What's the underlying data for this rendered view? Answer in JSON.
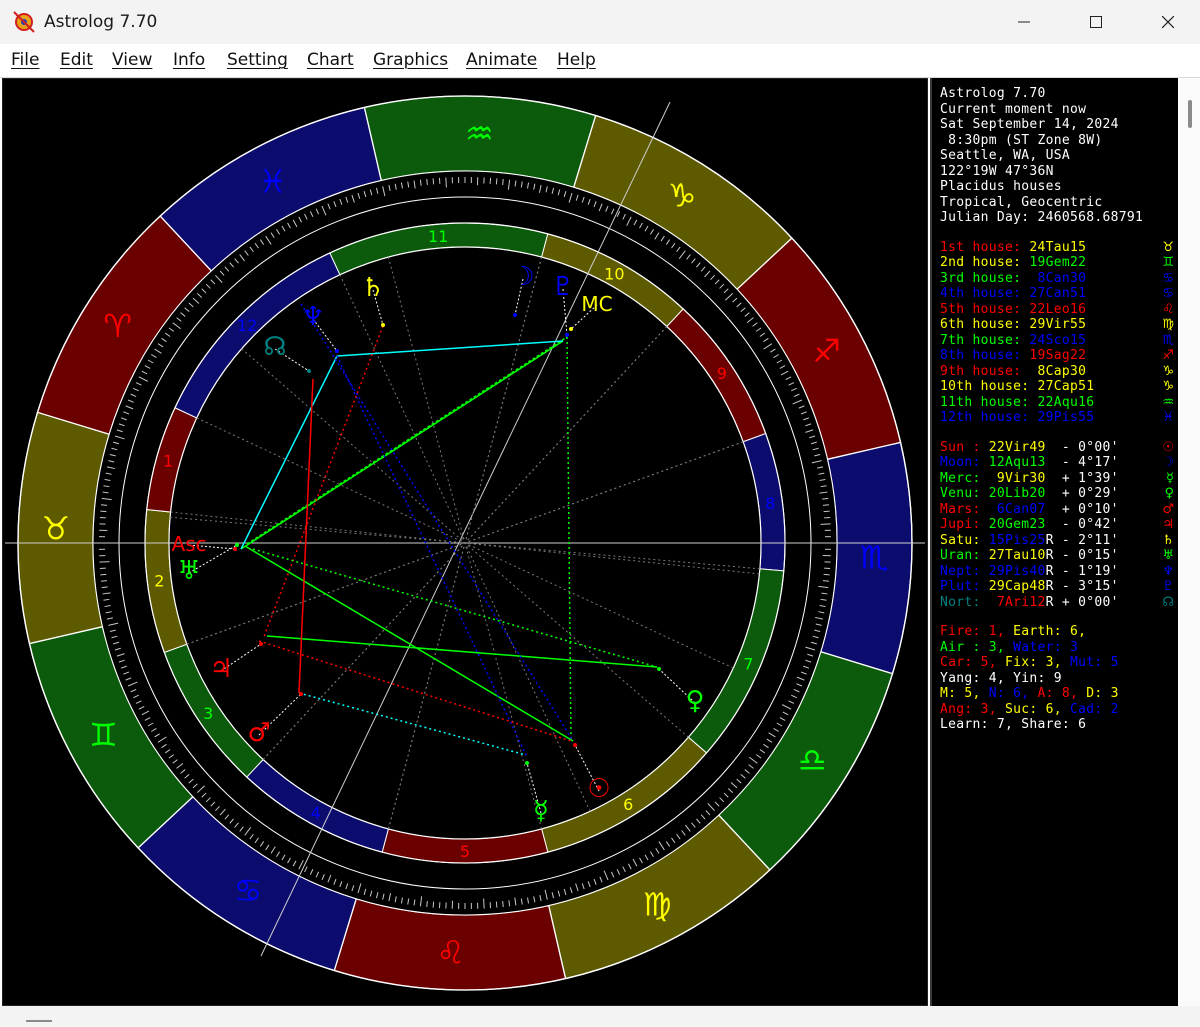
{
  "window": {
    "title": "Astrolog 7.70"
  },
  "menu": [
    {
      "label": "File"
    },
    {
      "label": "Edit"
    },
    {
      "label": "View"
    },
    {
      "label": "Info"
    },
    {
      "label": "Setting"
    },
    {
      "label": "Chart"
    },
    {
      "label": "Graphics"
    },
    {
      "label": "Animate"
    },
    {
      "label": "Help"
    }
  ],
  "chart": {
    "signs": [
      {
        "symbol": "♓",
        "color": "#0000ff"
      },
      {
        "symbol": "♒",
        "color": "#00ff00"
      },
      {
        "symbol": "♑",
        "color": "#ffff00"
      },
      {
        "symbol": "♐",
        "color": "#ff0000"
      },
      {
        "symbol": "♏",
        "color": "#0000ff"
      },
      {
        "symbol": "♎",
        "color": "#00ff00"
      },
      {
        "symbol": "♍",
        "color": "#ffff00"
      },
      {
        "symbol": "♌",
        "color": "#ff0000"
      },
      {
        "symbol": "♋",
        "color": "#0000ff"
      },
      {
        "symbol": "♊",
        "color": "#00ff00"
      },
      {
        "symbol": "♉",
        "color": "#ffff00"
      },
      {
        "symbol": "♈",
        "color": "#ff0000"
      }
    ],
    "houses": [
      {
        "num": "11",
        "color": "#00ff00"
      },
      {
        "num": "10",
        "color": "#ffff00"
      },
      {
        "num": "9",
        "color": "#ff0000"
      },
      {
        "num": "8",
        "color": "#0000ff"
      },
      {
        "num": "7",
        "color": "#00ff00"
      },
      {
        "num": "6",
        "color": "#ffff00"
      },
      {
        "num": "5",
        "color": "#ff0000"
      },
      {
        "num": "4",
        "color": "#0000ff"
      },
      {
        "num": "3",
        "color": "#00ff00"
      },
      {
        "num": "2",
        "color": "#ffff00"
      },
      {
        "num": "1",
        "color": "#ff0000"
      },
      {
        "num": "12",
        "color": "#0000ff"
      }
    ],
    "points": [
      {
        "name": "Saturn",
        "glyph": "♄",
        "color": "#ffff00"
      },
      {
        "name": "Neptune",
        "glyph": "♆",
        "color": "#0000ff"
      },
      {
        "name": "North Node",
        "glyph": "☊",
        "color": "#008080"
      },
      {
        "name": "Moon",
        "glyph": "☽",
        "color": "#0000ff"
      },
      {
        "name": "Pluto",
        "glyph": "♇",
        "color": "#0000ff"
      },
      {
        "name": "MC",
        "glyph": "MC",
        "color": "#ffff00"
      },
      {
        "name": "Asc",
        "glyph": "Asc",
        "color": "#ff0000"
      },
      {
        "name": "Uranus",
        "glyph": "♅",
        "color": "#00ff00"
      },
      {
        "name": "Jupiter",
        "glyph": "♃",
        "color": "#ff0000"
      },
      {
        "name": "Mars",
        "glyph": "♂",
        "color": "#ff0000"
      },
      {
        "name": "Venus",
        "glyph": "♀",
        "color": "#00ff00"
      },
      {
        "name": "Sun",
        "glyph": "☉",
        "color": "#ff0000"
      },
      {
        "name": "Mercury",
        "glyph": "☿",
        "color": "#00ff00"
      }
    ]
  },
  "info": {
    "header": [
      "Astrolog 7.70",
      "Current moment now",
      "Sat September 14, 2024",
      " 8:30pm (ST Zone 8W)",
      "Seattle, WA, USA",
      "122°19W 47°36N",
      "Placidus houses",
      "Tropical, Geocentric",
      "Julian Day: 2460568.68791"
    ],
    "houses": [
      {
        "label": "1st house:",
        "value": "24Tau15",
        "glyph": "♉",
        "color": "#ff0000",
        "vcolor": "#ffff00"
      },
      {
        "label": "2nd house:",
        "value": "19Gem22",
        "glyph": "♊",
        "color": "#ffff00",
        "vcolor": "#00ff00"
      },
      {
        "label": "3rd house:",
        "value": " 8Can30",
        "glyph": "♋",
        "color": "#00ff00",
        "vcolor": "#0000ff"
      },
      {
        "label": "4th house:",
        "value": "27Can51",
        "glyph": "♋",
        "color": "#0000ff",
        "vcolor": "#0000ff"
      },
      {
        "label": "5th house:",
        "value": "22Leo16",
        "glyph": "♌",
        "color": "#ff0000",
        "vcolor": "#ff0000"
      },
      {
        "label": "6th house:",
        "value": "29Vir55",
        "glyph": "♍",
        "color": "#ffff00",
        "vcolor": "#ffff00"
      },
      {
        "label": "7th house:",
        "value": "24Sco15",
        "glyph": "♏",
        "color": "#00ff00",
        "vcolor": "#0000ff"
      },
      {
        "label": "8th house:",
        "value": "19Sag22",
        "glyph": "♐",
        "color": "#0000ff",
        "vcolor": "#ff0000"
      },
      {
        "label": "9th house:",
        "value": " 8Cap30",
        "glyph": "♑",
        "color": "#ff0000",
        "vcolor": "#ffff00"
      },
      {
        "label": "10th house:",
        "value": "27Cap51",
        "glyph": "♑",
        "color": "#ffff00",
        "vcolor": "#ffff00"
      },
      {
        "label": "11th house:",
        "value": "22Aqu16",
        "glyph": "♒",
        "color": "#00ff00",
        "vcolor": "#00ff00"
      },
      {
        "label": "12th house:",
        "value": "29Pis55",
        "glyph": "♓",
        "color": "#0000ff",
        "vcolor": "#0000ff"
      }
    ],
    "planets": [
      {
        "label": "Sun :",
        "value": "22Vir49",
        "lat": "- 0°00'",
        "glyph": "☉",
        "color": "#ff0000",
        "vcolor": "#ffff00"
      },
      {
        "label": "Moon:",
        "value": "12Aqu13",
        "lat": "- 4°17'",
        "glyph": "☽",
        "color": "#0000ff",
        "vcolor": "#00ff00"
      },
      {
        "label": "Merc:",
        "value": " 9Vir30",
        "lat": "+ 1°39'",
        "glyph": "☿",
        "color": "#00ff00",
        "vcolor": "#ffff00"
      },
      {
        "label": "Venu:",
        "value": "20Lib20",
        "lat": "+ 0°29'",
        "glyph": "♀",
        "color": "#00ff00",
        "vcolor": "#00ff00"
      },
      {
        "label": "Mars:",
        "value": " 6Can07",
        "lat": "+ 0°10'",
        "glyph": "♂",
        "color": "#ff0000",
        "vcolor": "#0000ff"
      },
      {
        "label": "Jupi:",
        "value": "20Gem23",
        "lat": "- 0°42'",
        "glyph": "♃",
        "color": "#ff0000",
        "vcolor": "#00ff00"
      },
      {
        "label": "Satu:",
        "value": "15Pis25",
        "retro": "R",
        "lat": "- 2°11'",
        "glyph": "♄",
        "color": "#ffff00",
        "vcolor": "#0000ff"
      },
      {
        "label": "Uran:",
        "value": "27Tau10",
        "retro": "R",
        "lat": "- 0°15'",
        "glyph": "♅",
        "color": "#00ff00",
        "vcolor": "#ffff00"
      },
      {
        "label": "Nept:",
        "value": "29Pis40",
        "retro": "R",
        "lat": "- 1°19'",
        "glyph": "♆",
        "color": "#0000ff",
        "vcolor": "#0000ff"
      },
      {
        "label": "Plut:",
        "value": "29Cap48",
        "retro": "R",
        "lat": "- 3°15'",
        "glyph": "♇",
        "color": "#0000ff",
        "vcolor": "#ffff00"
      },
      {
        "label": "Nort:",
        "value": " 7Ari12",
        "retro": "R",
        "lat": "+ 0°00'",
        "glyph": "☊",
        "color": "#008080",
        "vcolor": "#ff0000"
      }
    ],
    "summary": [
      [
        {
          "t": "Fire: 1, ",
          "c": "#ff0000"
        },
        {
          "t": "Earth: 6,",
          "c": "#ffff00"
        }
      ],
      [
        {
          "t": "Air : 3, ",
          "c": "#00ff00"
        },
        {
          "t": "Water: 3",
          "c": "#0000ff"
        }
      ],
      [
        {
          "t": "Car: 5, ",
          "c": "#ff0000"
        },
        {
          "t": "Fix: 3, ",
          "c": "#ffff00"
        },
        {
          "t": "Mut: 5",
          "c": "#0000ff"
        }
      ],
      [
        {
          "t": "Yang: 4, Yin: 9",
          "c": "#ffffff"
        }
      ],
      [
        {
          "t": "M: 5, ",
          "c": "#ffff00"
        },
        {
          "t": "N: 6, ",
          "c": "#0000ff"
        },
        {
          "t": "A: 8, ",
          "c": "#ff0000"
        },
        {
          "t": "D: 3",
          "c": "#ffff00"
        }
      ],
      [
        {
          "t": "Ang: 3, ",
          "c": "#ff0000"
        },
        {
          "t": "Suc: 6, ",
          "c": "#ffff00"
        },
        {
          "t": "Cad: 2",
          "c": "#0000ff"
        }
      ],
      [
        {
          "t": "Learn: 7, Share: 6",
          "c": "#ffffff"
        }
      ]
    ]
  }
}
